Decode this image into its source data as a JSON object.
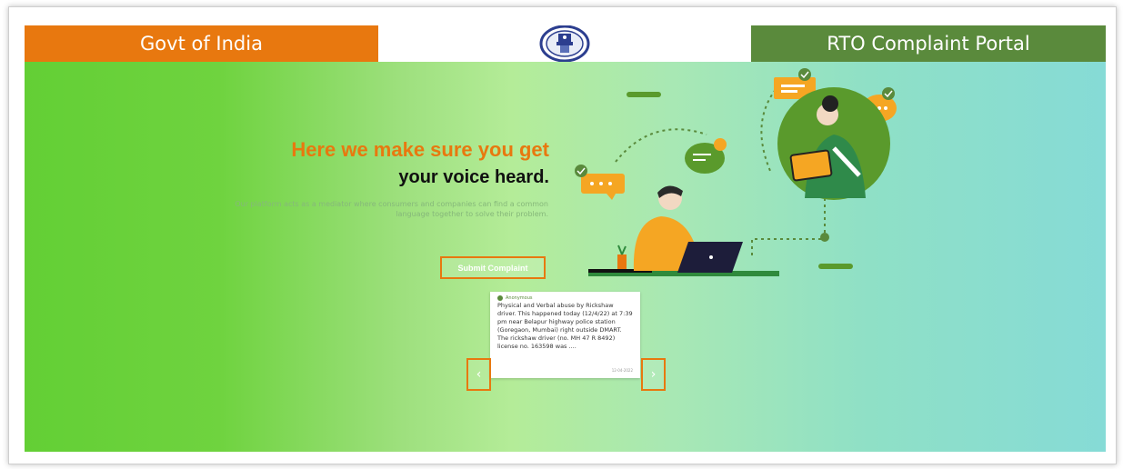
{
  "header": {
    "left_label": "Govt of India",
    "right_label": "RTO Complaint Portal",
    "emblem_icon": "national-emblem-icon"
  },
  "hero": {
    "headline_line1": "Here we make sure you get",
    "headline_line2": "your voice heard.",
    "subtitle": "Our platform acts as a mediator where consumers and companies can find a common language together to solve their problem.",
    "submit_label": "Submit Complaint"
  },
  "complaint_card": {
    "username": "Anonymous",
    "text": "Physical and Verbal abuse by Rickshaw driver. This happened today (12/4/22) at 7:39 pm near Belapur highway police station (Goregaon, Mumbai) right outside DMART. The rickshaw driver (no. MH 47 R 8492) license no. 163598 was ....",
    "date": "12-04-2022",
    "prev_icon": "chevron-left-icon",
    "next_icon": "chevron-right-icon",
    "prev_glyph": "‹",
    "next_glyph": "›"
  },
  "colors": {
    "orange": "#e8780f",
    "green_dark": "#5a8a3c",
    "hero_left": "#63cf35",
    "hero_right": "#86dbd6"
  }
}
